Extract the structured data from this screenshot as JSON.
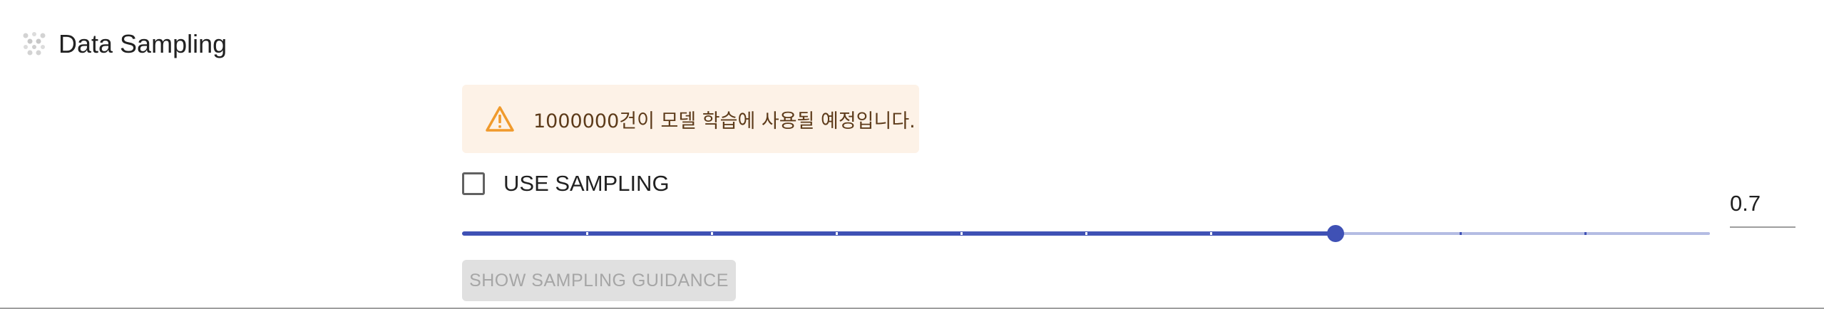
{
  "section": {
    "title": "Data Sampling",
    "icon": "dots-grid-icon"
  },
  "alert": {
    "icon": "warning-triangle-icon",
    "message": "1000000건이 모델 학습에 사용될 예정입니다.",
    "background": "#fdf2e7",
    "icon_color": "#f09a2c"
  },
  "sampling": {
    "checkbox_label": "USE SAMPLING",
    "checked": false
  },
  "slider": {
    "min": 0,
    "max": 1,
    "step": 0.1,
    "value": 0.7,
    "accent": "#3f51b5",
    "rail_color": "#b4bce3"
  },
  "value_field": {
    "value": "0.7"
  },
  "guidance_button": {
    "label": "SHOW SAMPLING GUIDANCE",
    "disabled": true
  }
}
